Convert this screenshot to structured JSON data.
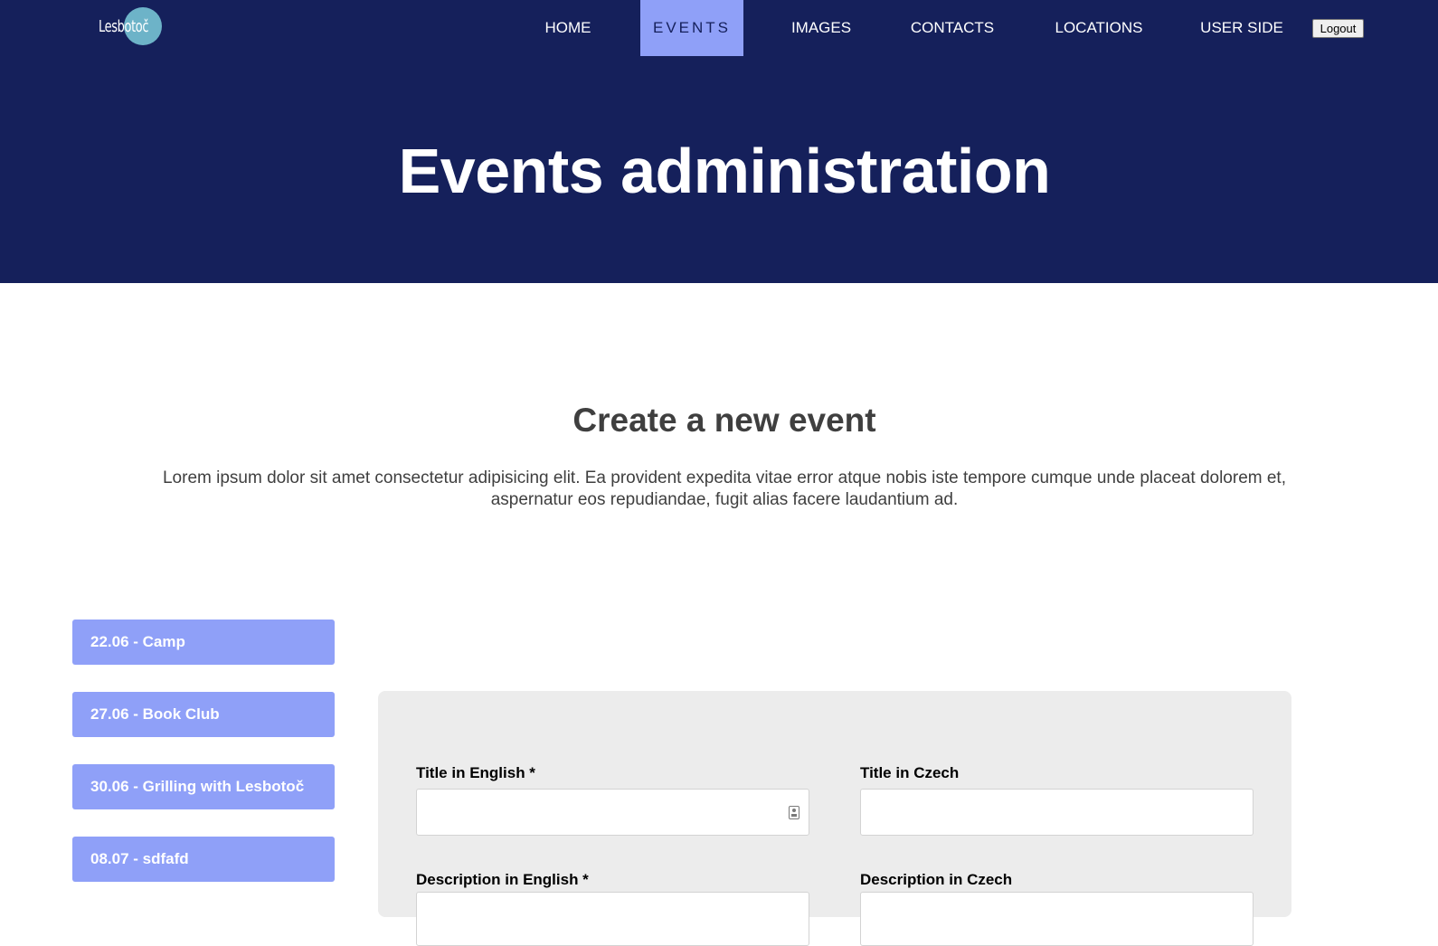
{
  "header": {
    "logo_text": "Lesbotoč",
    "nav": [
      {
        "label": "HOME"
      },
      {
        "label": "EVENTS",
        "active": true
      },
      {
        "label": "IMAGES"
      },
      {
        "label": "CONTACTS"
      },
      {
        "label": "LOCATIONS"
      },
      {
        "label": "USER SIDE"
      }
    ],
    "logout_label": "Logout"
  },
  "hero": {
    "title": "Events administration"
  },
  "intro": {
    "title": "Create a new event",
    "description": "Lorem ipsum dolor sit amet consectetur adipisicing elit. Ea provident expedita vitae error atque nobis iste tempore cumque unde placeat dolorem et, aspernatur eos repudiandae, fugit alias facere laudantium ad."
  },
  "events": [
    {
      "label": "22.06 - Camp"
    },
    {
      "label": "27.06 - Book Club"
    },
    {
      "label": "30.06 - Grilling with Lesbotoč"
    },
    {
      "label": "08.07 - sdfafd"
    }
  ],
  "form": {
    "title_en_label": "Title in English *",
    "title_en_value": "",
    "title_cz_label": "Title in Czech",
    "title_cz_value": "",
    "desc_en_label": "Description in English *",
    "desc_cz_label": "Description in Czech"
  },
  "colors": {
    "header_bg": "#15205b",
    "accent": "#8fa0f8",
    "panel_bg": "#ececec",
    "logo_circle": "#6db3c8"
  }
}
